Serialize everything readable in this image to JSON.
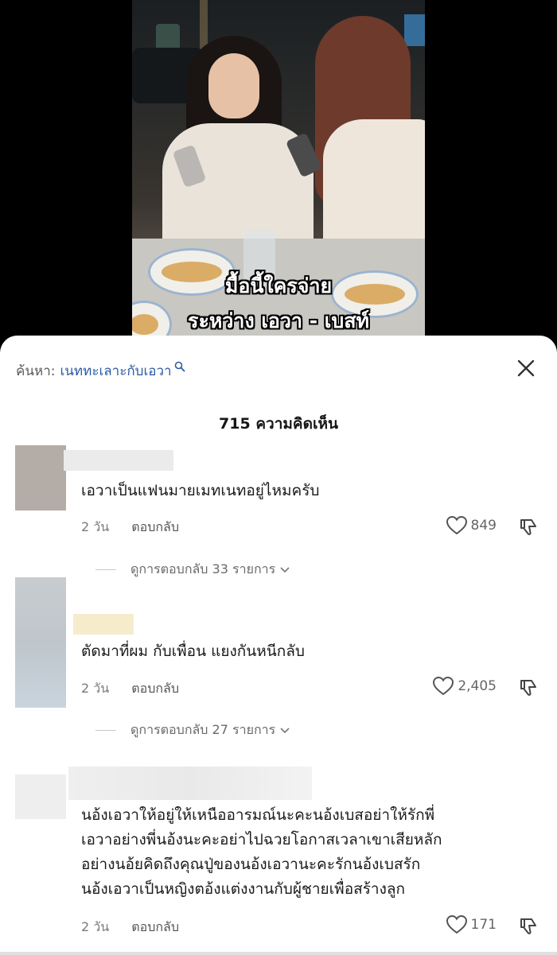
{
  "video": {
    "subtitle_line1": "มื้อนี้ใครจ่าย",
    "subtitle_line2": "ระหว่าง เอวา - เบสท์"
  },
  "search": {
    "prefix": "ค้นหา:",
    "term": "เนททะเลาะกับเอวา"
  },
  "comments_header": {
    "count_label": "715 ความคิดเห็น"
  },
  "comments": [
    {
      "text_lines": [
        "เอวาเป็นแฟนมายเมทเนทอยู่ไหมครับ"
      ],
      "time": "2 วัน",
      "reply_label": "ตอบกลับ",
      "likes": "849",
      "view_replies": "ดูการตอบกลับ 33 รายการ"
    },
    {
      "text_lines": [
        "ตัดมาที่ผม กับเพื่อน แยงกันหนีกลับ"
      ],
      "time": "2 วัน",
      "reply_label": "ตอบกลับ",
      "likes": "2,405",
      "view_replies": "ดูการตอบกลับ 27 รายการ"
    },
    {
      "text_lines": [
        "นอ้งเอวาให้อยู่ให้เหนืออารมณ์นะคะนอ้งเบสอย่าให้รักพี่",
        "เอวาอย่างพี่นอ้งนะคะอย่าไปฉวยโอกาสเวลาเขาเสียหลัก",
        "อย่างนอ้ยคิดถึงคุณปู่ของนอ้งเอวานะคะรักนอ้งเบสรัก",
        "นอ้งเอวาเป็นหญิงตอ้งแต่งงานกับผู้ชายเพื่อสร้างลูก"
      ],
      "time": "2 วัน",
      "reply_label": "ตอบกลับ",
      "likes": "171"
    }
  ],
  "colors": {
    "search_term": "#2b5aa3",
    "sheet_bg": "#ffffff",
    "muted_text": "#7a7a7a"
  }
}
